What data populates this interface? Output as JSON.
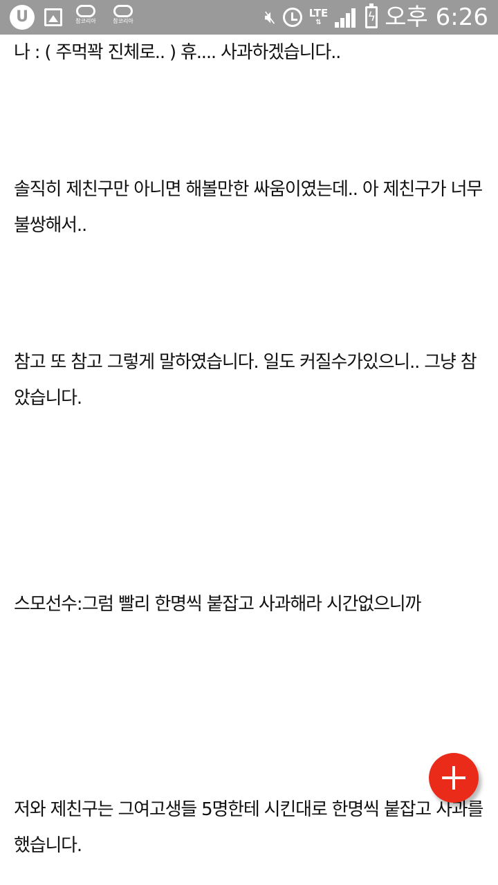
{
  "status_bar": {
    "time": "오후 6:26",
    "network_label": "LTE",
    "notification_icons": [
      "u-plus-icon",
      "gallery-icon",
      "refcorea-app-icon",
      "refcorea-app-icon"
    ],
    "ref_app_label_1": "참코리아",
    "ref_app_label_2": "참코리아",
    "status_icons": [
      "mute-icon",
      "alarm-icon",
      "lte-icon",
      "signal-icon",
      "battery-charging-icon"
    ],
    "color": "#9a9a9a"
  },
  "article": {
    "paragraphs": [
      "나 : ( 주먹꽉 진체로.. ) 휴.... 사과하겠습니다..",
      "솔직히 제친구만 아니면 해볼만한 싸움이였는데.. 아 제친구가 너무 불쌍해서..",
      "참고 또 참고 그렇게 말하였습니다. 일도 커질수가있으니.. 그냥 참았습니다.",
      "스모선수:그럼 빨리 한명씩 붙잡고 사과해라 시간없으니까",
      "저와 제친구는 그여고생들 5명한테 시킨대로 한명씩 붙잡고 사과를했습니다."
    ]
  },
  "fab": {
    "icon": "plus-icon",
    "color": "#ea2b1a"
  }
}
